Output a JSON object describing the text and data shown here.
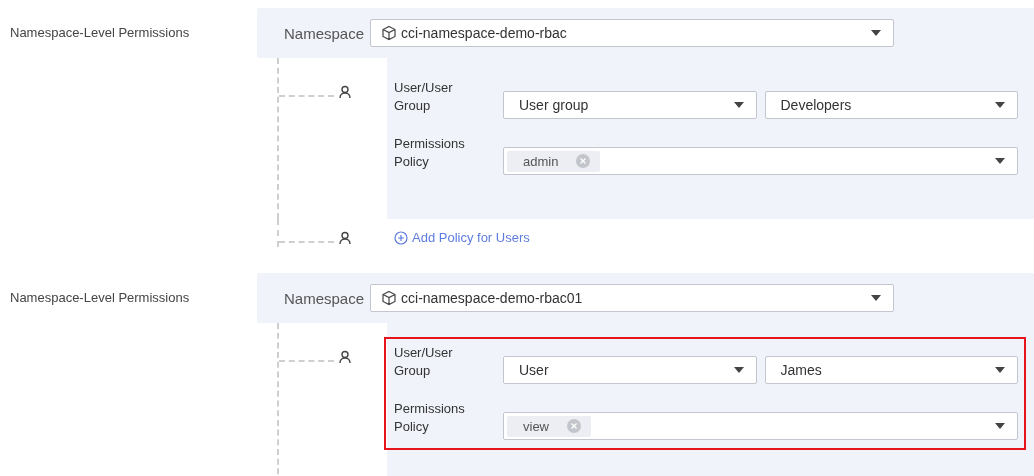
{
  "sections": [
    {
      "label": "Namespace-Level Permissions",
      "namespace": {
        "label": "Namespace",
        "value": "cci-namespace-demo-rbac"
      },
      "entries": [
        {
          "highlighted": false,
          "type_label": "User/User Group",
          "type_value": "User group",
          "name_value": "Developers",
          "policy_label": "Permissions Policy",
          "policies": [
            "admin"
          ]
        }
      ],
      "add_link": "Add Policy for Users"
    },
    {
      "label": "Namespace-Level Permissions",
      "namespace": {
        "label": "Namespace",
        "value": "cci-namespace-demo-rbac01"
      },
      "entries": [
        {
          "highlighted": true,
          "type_label": "User/User Group",
          "type_value": "User",
          "name_value": "James",
          "policy_label": "Permissions Policy",
          "policies": [
            "view"
          ]
        }
      ]
    }
  ]
}
